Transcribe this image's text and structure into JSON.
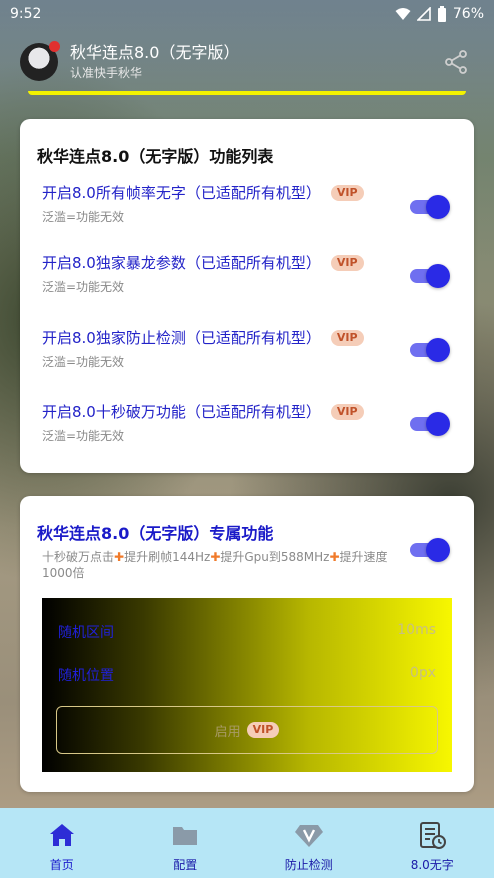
{
  "status_bar": {
    "time": "9:52",
    "battery": "76%",
    "icons": [
      "wifi-icon",
      "signal-icon",
      "battery-icon"
    ]
  },
  "header": {
    "title": "秋华连点8.0（无字版）",
    "subtitle": "认准快手秋华",
    "share_icon": "share-icon"
  },
  "card1": {
    "title": "秋华连点8.0（无字版）功能列表",
    "features": [
      {
        "label": "开启8.0所有帧率无字（已适配所有机型）",
        "badge": "VIP",
        "sub": "泛滥=功能无效",
        "enabled": true
      },
      {
        "label": "开启8.0独家暴龙参数（已适配所有机型）",
        "badge": "VIP",
        "sub": "泛滥=功能无效",
        "enabled": true
      },
      {
        "label": "开启8.0独家防止检测（已适配所有机型）",
        "badge": "VIP",
        "sub": "泛滥=功能无效",
        "enabled": true
      },
      {
        "label": "开启8.0十秒破万功能（已适配所有机型）",
        "badge": "VIP",
        "sub": "泛滥=功能无效",
        "enabled": true
      }
    ]
  },
  "card2": {
    "title": "秋华连点8.0（无字版）专属功能",
    "desc_parts": [
      "十秒破万点击",
      "提升刷帧144Hz",
      "提升Gpu到588MHz",
      "提升速度1000倍"
    ],
    "enabled": true,
    "panel": {
      "row1_label": "随机区间",
      "row1_value": "10ms",
      "row2_label": "随机位置",
      "row2_value": "0px",
      "button_label": "启用",
      "button_badge": "VIP"
    }
  },
  "bottom_nav": {
    "items": [
      {
        "label": "首页",
        "icon": "home-icon"
      },
      {
        "label": "配置",
        "icon": "folder-icon"
      },
      {
        "label": "防止检测",
        "icon": "diamond-v-icon"
      },
      {
        "label": "8.0无字",
        "icon": "clipboard-clock-icon"
      }
    ]
  },
  "colors": {
    "accent": "#2a2ae6",
    "link_text": "#2323c8",
    "vip_bg": "#f5cdb8",
    "nav_bg": "#b6e6f6",
    "header_underline": "#f3f200"
  }
}
